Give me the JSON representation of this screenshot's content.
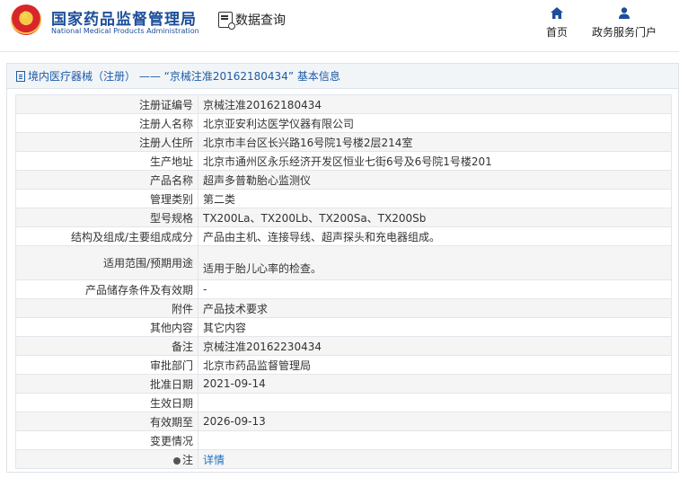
{
  "header": {
    "brand_cn": "国家药品监督管理局",
    "brand_en": "National Medical Products Administration",
    "query_label": "数据查询",
    "nav": [
      {
        "label": "首页",
        "icon": "home-icon"
      },
      {
        "label": "政务服务门户",
        "icon": "user-icon"
      }
    ],
    "accent": "#1d4e9a"
  },
  "panel": {
    "title": "境内医疗器械（注册） —— “京械注准20162180434” 基本信息"
  },
  "rows": [
    {
      "label": "注册证编号",
      "value": "京械注准20162180434"
    },
    {
      "label": "注册人名称",
      "value": "北京亚安利达医学仪器有限公司"
    },
    {
      "label": "注册人住所",
      "value": "北京市丰台区长兴路16号院1号楼2层214室"
    },
    {
      "label": "生产地址",
      "value": "北京市通州区永乐经济开发区恒业七街6号及6号院1号楼201"
    },
    {
      "label": "产品名称",
      "value": "超声多普勒胎心监测仪"
    },
    {
      "label": "管理类别",
      "value": "第二类"
    },
    {
      "label": "型号规格",
      "value": "TX200La、TX200Lb、TX200Sa、TX200Sb"
    },
    {
      "label": "结构及组成/主要组成成分",
      "value": "产品由主机、连接导线、超声探头和充电器组成。"
    },
    {
      "label": "适用范围/预期用途",
      "value": "适用于胎儿心率的检查。"
    },
    {
      "label": "产品储存条件及有效期",
      "value": "-"
    },
    {
      "label": "附件",
      "value": "产品技术要求"
    },
    {
      "label": "其他内容",
      "value": "其它内容"
    },
    {
      "label": "备注",
      "value": "京械注准20162230434"
    },
    {
      "label": "审批部门",
      "value": "北京市药品监督管理局"
    },
    {
      "label": "批准日期",
      "value": "2021-09-14"
    },
    {
      "label": "生效日期",
      "value": ""
    },
    {
      "label": "有效期至",
      "value": "2026-09-13"
    },
    {
      "label": "变更情况",
      "value": ""
    },
    {
      "label": "注",
      "value": "详情"
    }
  ]
}
